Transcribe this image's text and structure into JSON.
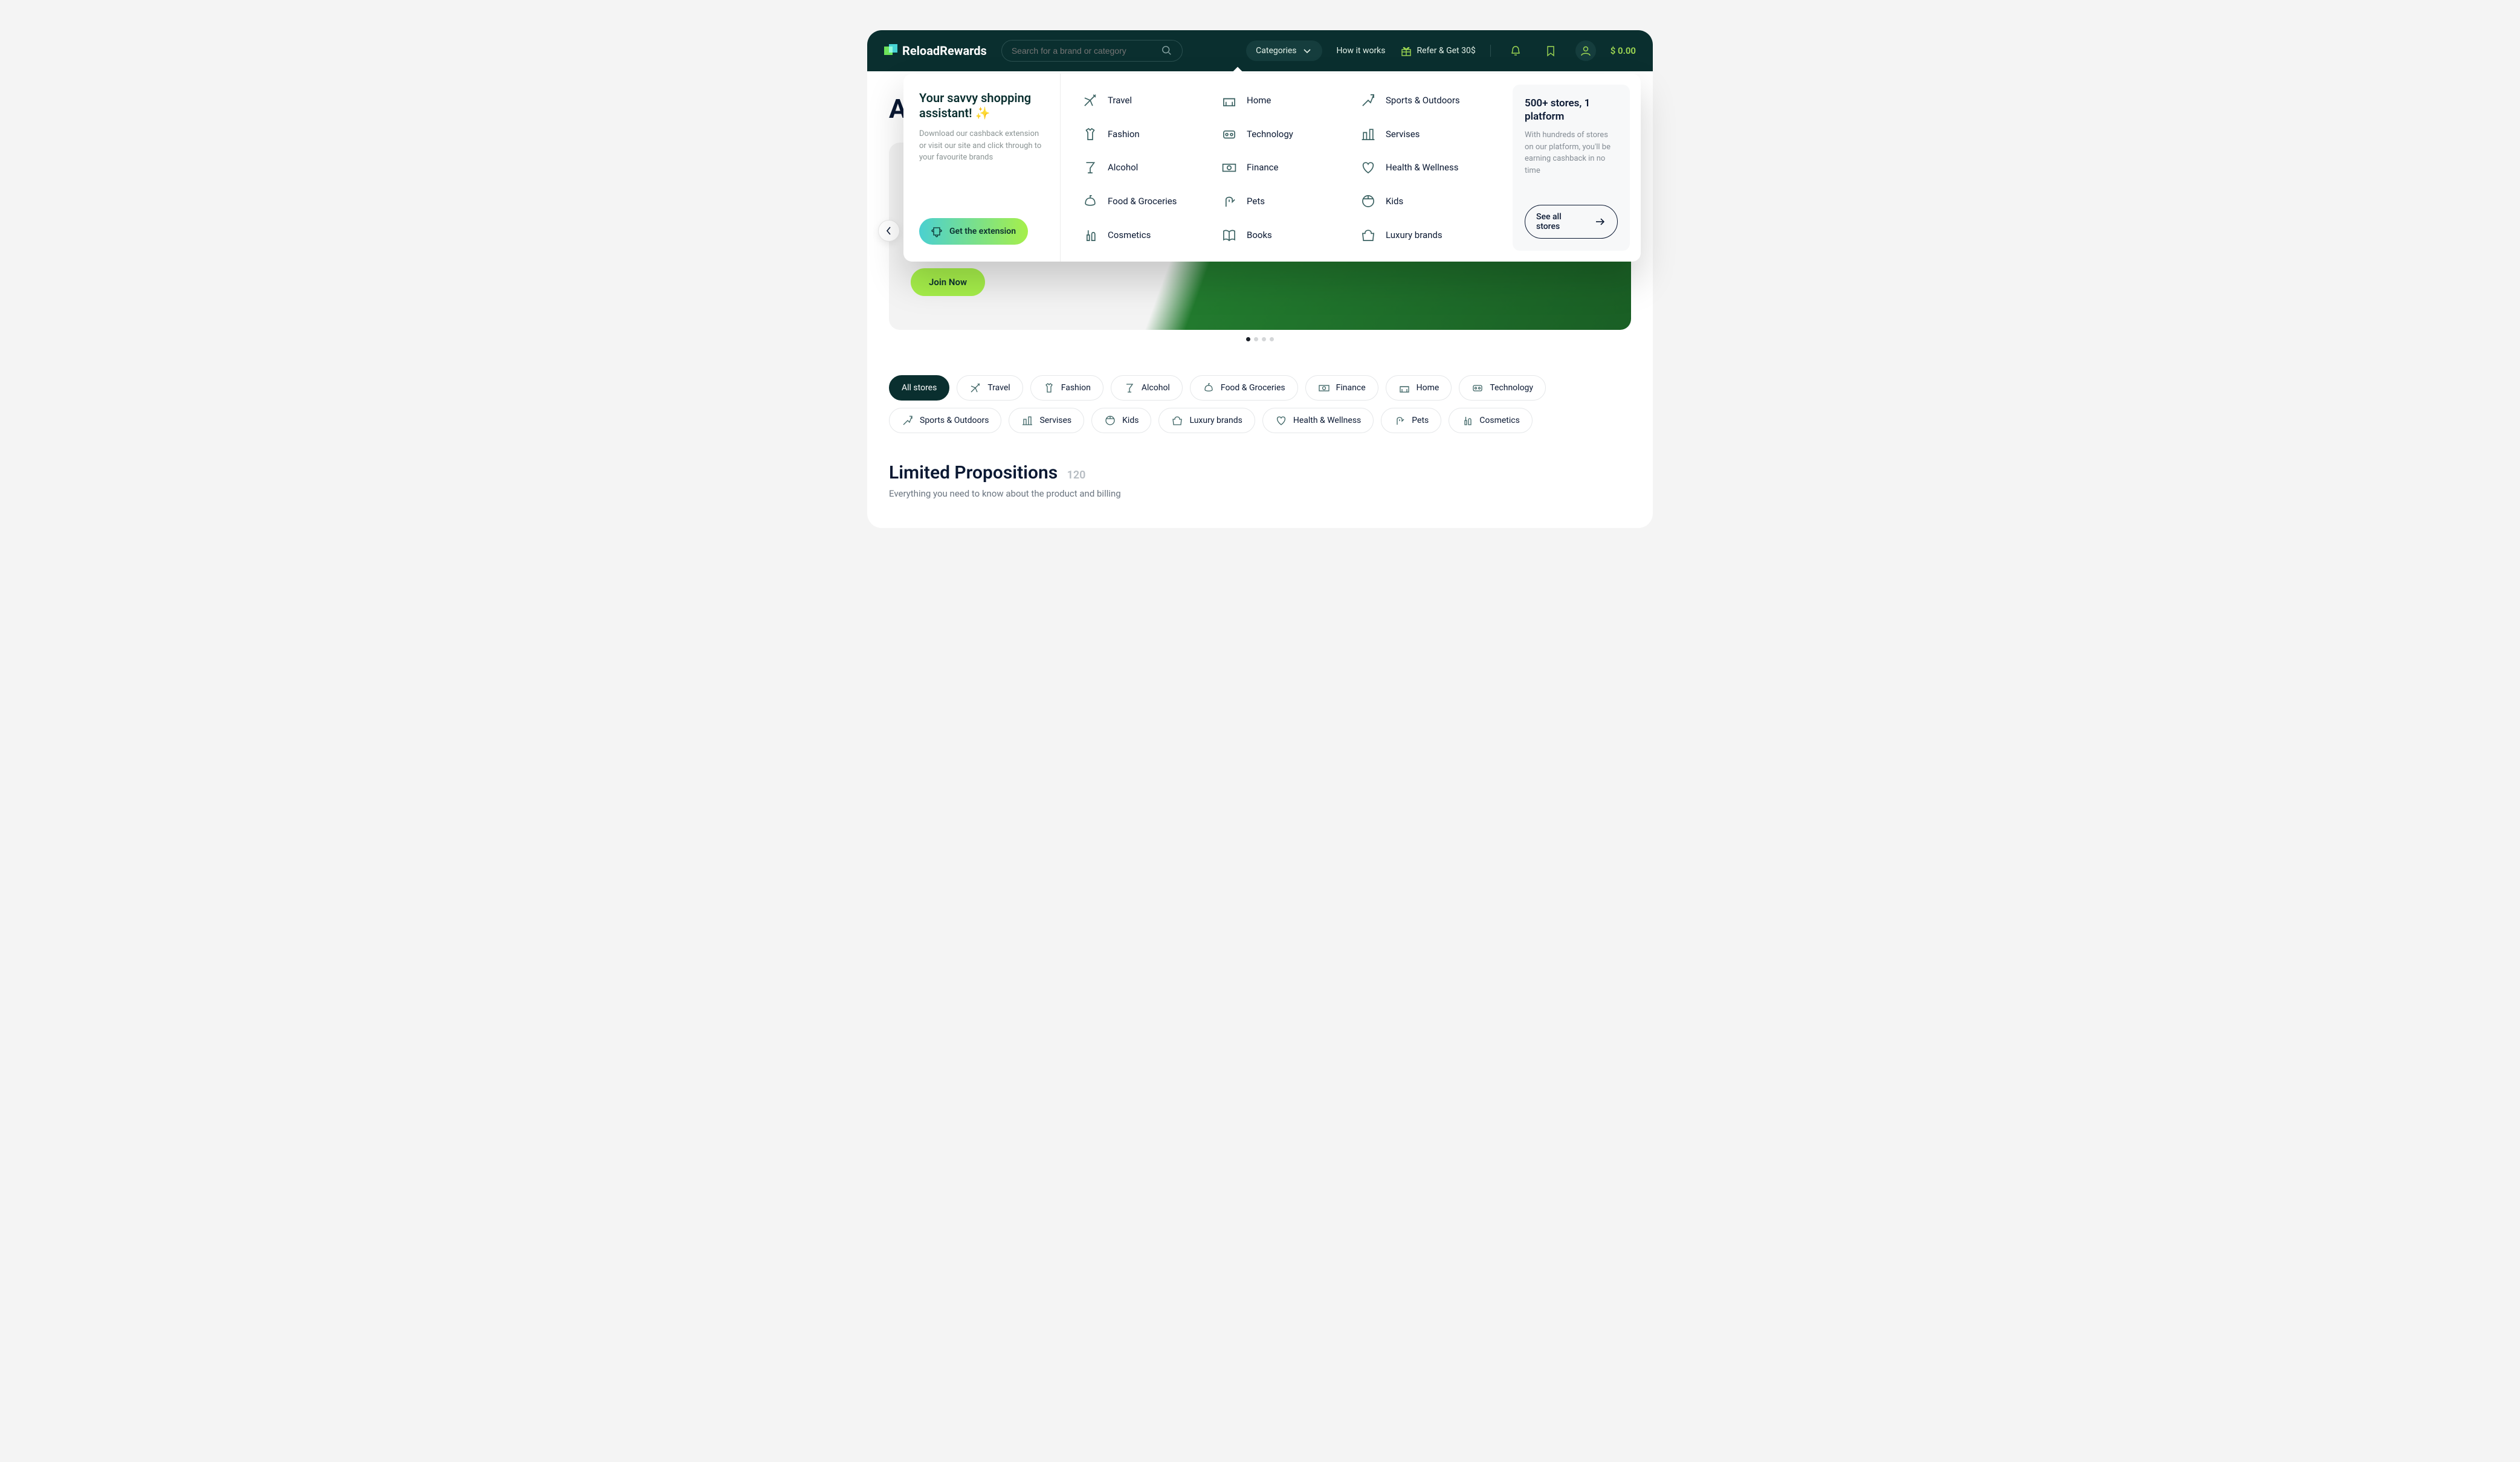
{
  "header": {
    "brand": "ReloadRewards",
    "search_placeholder": "Search for a brand or category",
    "categories_label": "Categories",
    "how_it_works": "How it works",
    "refer": "Refer & Get 30$",
    "balance": "$ 0.00"
  },
  "mega": {
    "left_title": "Your savvy shopping assistant! ✨",
    "left_desc": "Download our cashback extension or visit our site and click through to your favourite brands",
    "ext_btn": "Get the extension",
    "categories": [
      "Travel",
      "Home",
      "Sports & Outdoors",
      "Fashion",
      "Technology",
      "Servises",
      "Alcohol",
      "Finance",
      "Health & Wellness",
      "Food & Groceries",
      "Pets",
      "Kids",
      "Cosmetics",
      "Books",
      "Luxury brands"
    ],
    "right_title": "500+ stores, 1 platform",
    "right_desc": "With hundreds of stores on our platform, you'll be earning cashback in no time",
    "see_all": "See all stores"
  },
  "hero": {
    "peek": "A",
    "join": "Join Now"
  },
  "chips": [
    "All stores",
    "Travel",
    "Fashion",
    "Alcohol",
    "Food & Groceries",
    "Finance",
    "Home",
    "Technology",
    "Sports & Outdoors",
    "Servises",
    "Kids",
    "Luxury brands",
    "Health & Wellness",
    "Pets",
    "Cosmetics"
  ],
  "limited": {
    "title": "Limited Propositions",
    "count": "120",
    "sub": "Everything you need to know about the product and billing"
  }
}
